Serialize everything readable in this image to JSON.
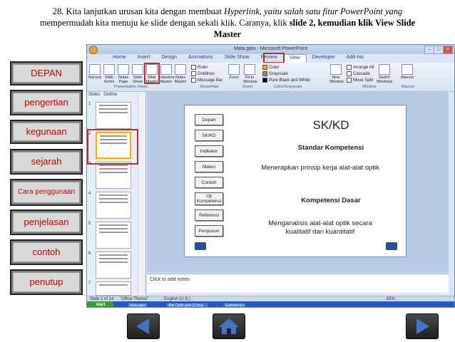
{
  "instruction": {
    "line1_prefix": "28. Kita lanjutkan urusan kita dengan membuat ",
    "line1_italic": "Hyperlink, yaitu salah satu fitur PowerPoint yang",
    "line2_prefix": "mempermudah kita menuju ke slide dengan sekali klik. Caranya, klik ",
    "line2_bold": "slide 2, kemudian klik View  Slide",
    "line3_bold": "Master"
  },
  "left_nav": {
    "items": [
      "DEPAN",
      "pengertian",
      "kegunaan",
      "sejarah",
      "Cara penggunaan",
      "penjelasan",
      "contoh",
      "penutup"
    ]
  },
  "window": {
    "title": "Mata.pptx - Microsoft PowerPoint",
    "tabs": [
      "Home",
      "Insert",
      "Design",
      "Animations",
      "Slide Show",
      "Review",
      "View",
      "Developer",
      "Add-Ins"
    ],
    "active_tab": "View",
    "ribbon": {
      "buttons": [
        "Normal",
        "Slide Sorter",
        "Notes Page",
        "Slide Show",
        "Slide Master",
        "Handout Master",
        "Notes Master"
      ],
      "checkboxes": [
        "Ruler",
        "Gridlines",
        "Message Bar"
      ],
      "zoom": [
        "Zoom",
        "Fit to Window"
      ],
      "color_options": [
        "Color",
        "Grayscale",
        "Pure Black and White"
      ],
      "window_buttons": [
        "New Window",
        "Arrange All",
        "Cascade",
        "Move Split",
        "Switch Windows"
      ],
      "macros": "Macros",
      "groups": [
        "Presentation Views",
        "Show/Hide",
        "Zoom",
        "Color/Grayscale",
        "Window",
        "Macros"
      ]
    },
    "pane_tabs": [
      "Slides",
      "Outline"
    ],
    "thumb_numbers": [
      "1",
      "2",
      "3",
      "4",
      "5",
      "6",
      "7"
    ],
    "slide": {
      "buttons": [
        "Depan",
        "SK/KD",
        "Indikator",
        "Materi",
        "Contoh",
        "Uji Kompetensi",
        "Referensi",
        "Penyusun"
      ],
      "title": "SK/KD",
      "heading1": "Standar Kompetensi",
      "text1": "Menerapkan prinsip kerja alat-alat optik",
      "heading2": "Kompetensi Dasar",
      "text2a": "Menganalisis alat-alat optik secara",
      "text2b": "kualitatif dan kuantitatif"
    },
    "notes_placeholder": "Click to add notes",
    "status": {
      "slide": "Slide 2 of 14",
      "theme": "\"Office Theme\"",
      "language": "English (U.S.)",
      "zoom": "65%"
    },
    "taskbar": {
      "start": "start",
      "items": [
        "Mata.pptx",
        "Alat Optik.pptx [Comp...",
        "Gambarnya"
      ]
    }
  },
  "colors": {
    "nav_text": "#c00000",
    "highlight_red": "#d0202a"
  }
}
